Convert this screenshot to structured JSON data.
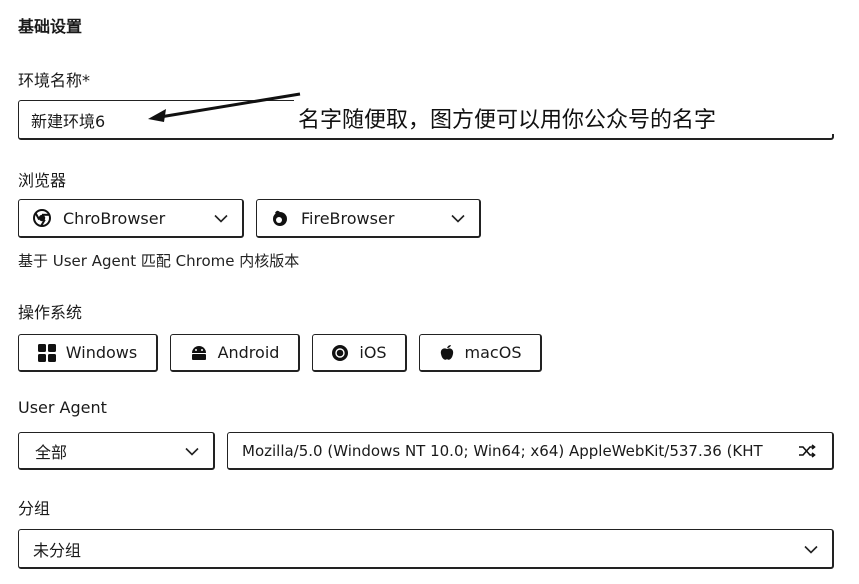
{
  "basic": {
    "title": "基础设置"
  },
  "env_name": {
    "label": "环境名称*",
    "value": "新建环境6",
    "annotation": "名字随便取，图方便可以用你公众号的名字"
  },
  "browser": {
    "label": "浏览器",
    "options": [
      {
        "name": "ChroBrowser",
        "icon": "chrome-icon"
      },
      {
        "name": "FireBrowser",
        "icon": "firefox-icon"
      }
    ],
    "hint": "基于 User Agent 匹配 Chrome 内核版本"
  },
  "os": {
    "label": "操作系统",
    "options": [
      {
        "name": "Windows",
        "icon": "windows-icon"
      },
      {
        "name": "Android",
        "icon": "android-icon"
      },
      {
        "name": "iOS",
        "icon": "ios-icon"
      },
      {
        "name": "macOS",
        "icon": "apple-icon"
      }
    ]
  },
  "ua": {
    "label": "User Agent",
    "filter": "全部",
    "value": "Mozilla/5.0 (Windows NT 10.0; Win64; x64) AppleWebKit/537.36 (KHT"
  },
  "group": {
    "label": "分组",
    "value": "未分组"
  }
}
